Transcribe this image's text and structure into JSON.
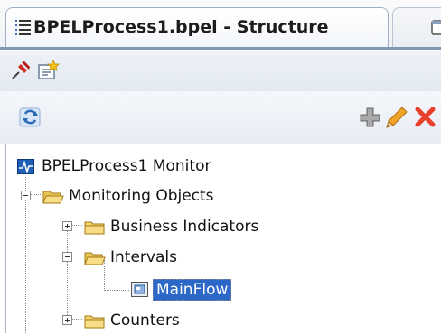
{
  "tab": {
    "title": "BPELProcess1.bpel - Structure",
    "icon": "structure-icon"
  },
  "tab2": {
    "icon": "window-icon"
  },
  "toolbar1": {
    "pin_icon": "pin-icon",
    "properties_icon": "properties-icon"
  },
  "toolbar2": {
    "refresh_icon": "refresh-icon",
    "add_icon": "add-icon",
    "edit_icon": "edit-icon",
    "delete_icon": "delete-icon"
  },
  "tree": {
    "root": {
      "label": "BPELProcess1 Monitor",
      "icon": "monitor-icon"
    },
    "monitoring_objects": {
      "label": "Monitoring Objects",
      "icon": "open-folder-icon",
      "expanded": true
    },
    "business_indicators": {
      "label": "Business Indicators",
      "icon": "folder-icon",
      "expanded": false
    },
    "intervals": {
      "label": "Intervals",
      "icon": "open-folder-icon",
      "expanded": true
    },
    "mainflow": {
      "label": "MainFlow",
      "icon": "interval-icon",
      "selected": true
    },
    "counters": {
      "label": "Counters",
      "icon": "folder-icon",
      "expanded": false
    }
  },
  "colors": {
    "selection": "#2c68c8",
    "folder": "#f5d36b",
    "delete": "#e8402a"
  }
}
